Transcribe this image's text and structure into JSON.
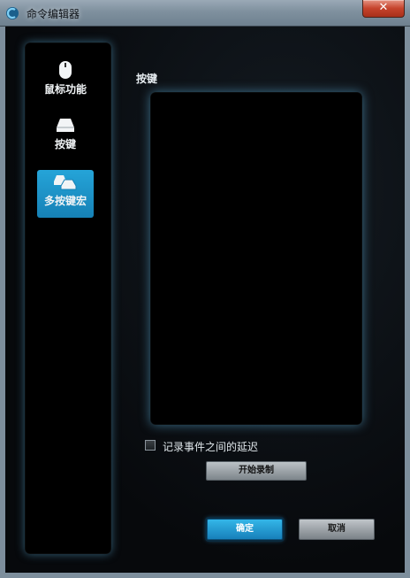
{
  "window": {
    "title": "命令编辑器",
    "close_label": "✕"
  },
  "nav": {
    "items": [
      {
        "label": "鼠标功能",
        "icon": "mouse-icon",
        "active": false
      },
      {
        "label": "按键",
        "icon": "key-icon",
        "active": false
      },
      {
        "label": "多按键宏",
        "icon": "multi-key-icon",
        "active": true
      }
    ]
  },
  "main": {
    "section_label": "按键",
    "delay_checkbox_label": "记录事件之间的延迟",
    "delay_checked": false,
    "record_button": "开始录制"
  },
  "footer": {
    "ok_button": "确定",
    "cancel_button": "取消"
  },
  "colors": {
    "accent": "#1e98cf",
    "glow": "#5aaad2",
    "background": "#07090c"
  }
}
